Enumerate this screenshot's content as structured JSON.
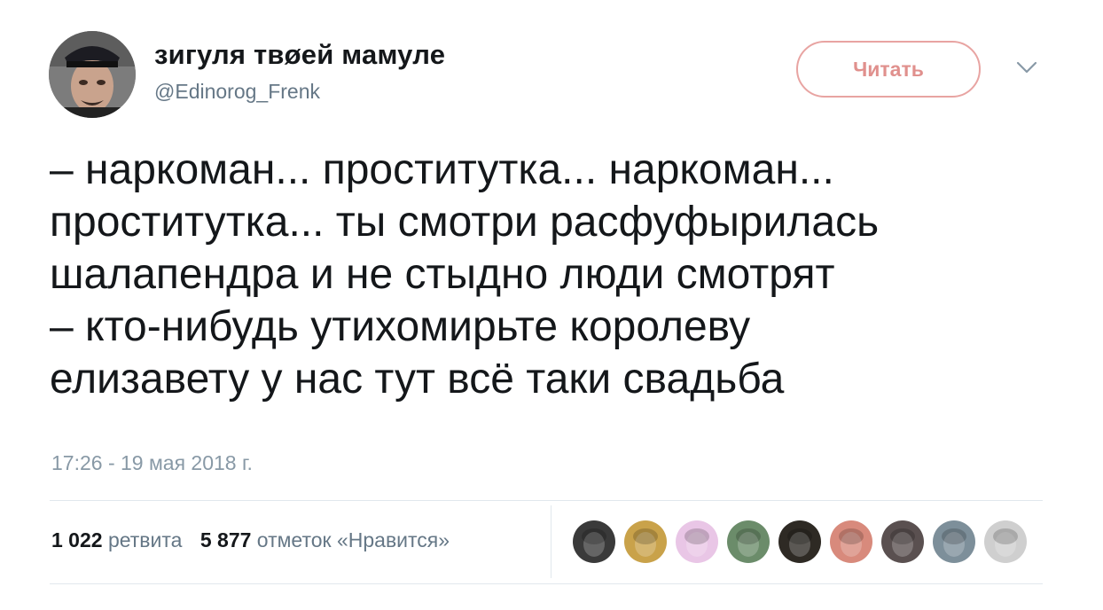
{
  "author": {
    "display_name": "зигуля твøей мамуле",
    "handle": "@Edinorog_Frenk"
  },
  "follow_button_label": "Читать",
  "tweet": {
    "text": "– наркоман... проститутка... наркоман...\nпроститутка... ты смотри расфуфырилась\nшалапендра и не стыдно люди смотрят\n– кто-нибудь утихомирьте королеву\nелизавету у нас тут всё таки свадьба",
    "timestamp": "17:26 - 19 мая 2018 г."
  },
  "stats": {
    "retweets_count": "1 022",
    "retweets_label": "ретвита",
    "likes_count": "5 877",
    "likes_label": "отметок «Нравится»"
  },
  "likers": [
    {
      "icon": "liker-avatar-1",
      "color": "#3a3a3a"
    },
    {
      "icon": "liker-avatar-2",
      "color": "#c9a24a"
    },
    {
      "icon": "liker-avatar-3",
      "color": "#e9c6e6"
    },
    {
      "icon": "liker-avatar-4",
      "color": "#6b8c6a"
    },
    {
      "icon": "liker-avatar-5",
      "color": "#2e2a24"
    },
    {
      "icon": "liker-avatar-6",
      "color": "#d88a7c"
    },
    {
      "icon": "liker-avatar-7",
      "color": "#5a5050"
    },
    {
      "icon": "liker-avatar-8",
      "color": "#7d8f9a"
    },
    {
      "icon": "liker-avatar-9",
      "color": "#cfcfcf"
    }
  ],
  "colors": {
    "follow_border": "#e8a4a2",
    "follow_text": "#e0908d",
    "secondary_text": "#657786",
    "divider": "#e1e8ed"
  }
}
